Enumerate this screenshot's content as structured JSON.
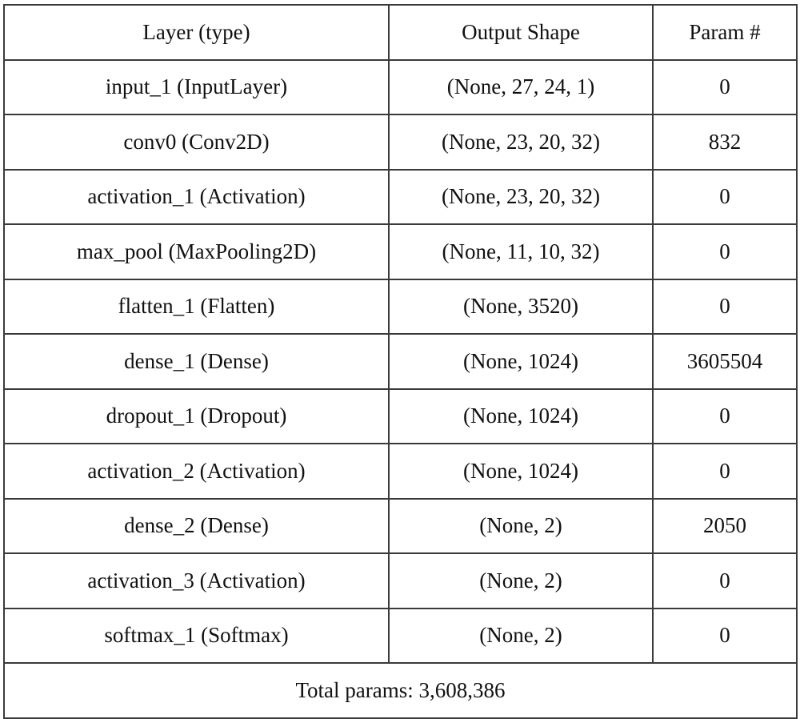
{
  "table": {
    "headers": {
      "layer": "Layer (type)",
      "output_shape": "Output Shape",
      "params": "Param #"
    },
    "rows": [
      {
        "layer": "input_1 (InputLayer)",
        "output_shape": "(None, 27, 24, 1)",
        "params": "0"
      },
      {
        "layer": "conv0 (Conv2D)",
        "output_shape": "(None, 23, 20, 32)",
        "params": "832"
      },
      {
        "layer": "activation_1 (Activation)",
        "output_shape": "(None, 23, 20, 32)",
        "params": "0"
      },
      {
        "layer": "max_pool (MaxPooling2D)",
        "output_shape": "(None, 11, 10, 32)",
        "params": "0"
      },
      {
        "layer": "flatten_1 (Flatten)",
        "output_shape": "(None, 3520)",
        "params": "0"
      },
      {
        "layer": "dense_1 (Dense)",
        "output_shape": "(None, 1024)",
        "params": "3605504"
      },
      {
        "layer": "dropout_1 (Dropout)",
        "output_shape": "(None, 1024)",
        "params": "0"
      },
      {
        "layer": "activation_2 (Activation)",
        "output_shape": "(None, 1024)",
        "params": "0"
      },
      {
        "layer": "dense_2 (Dense)",
        "output_shape": "(None, 2)",
        "params": "2050"
      },
      {
        "layer": "activation_3 (Activation)",
        "output_shape": "(None, 2)",
        "params": "0"
      },
      {
        "layer": "softmax_1 (Softmax)",
        "output_shape": "(None, 2)",
        "params": "0"
      }
    ],
    "total": "Total params: 3,608,386"
  }
}
